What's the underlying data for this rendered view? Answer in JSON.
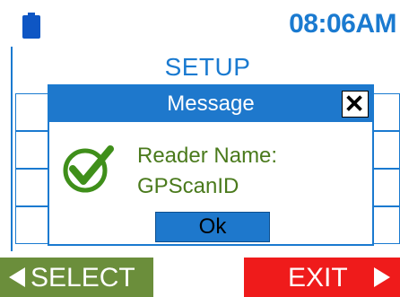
{
  "status": {
    "time": "08:06AM",
    "battery_icon": "battery-icon"
  },
  "screen": {
    "title": "SETUP"
  },
  "dialog": {
    "title": "Message",
    "line1": "Reader Name:",
    "line2": "GPScanID",
    "ok_label": "Ok",
    "close_icon": "close-icon",
    "status_icon": "check-circle-icon"
  },
  "buttons": {
    "select_label": "SELECT",
    "exit_label": "EXIT"
  },
  "colors": {
    "accent": "#1a7ad0",
    "select_bg": "#6b8e3b",
    "exit_bg": "#ef1b1b",
    "message_text": "#4a7a1c"
  }
}
